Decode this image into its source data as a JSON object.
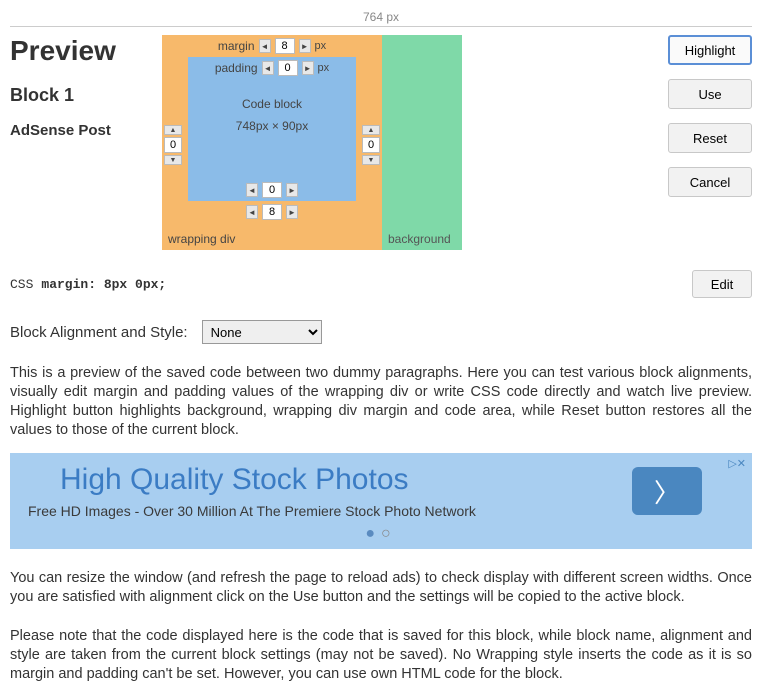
{
  "ruler": "764 px",
  "left": {
    "preview": "Preview",
    "block": "Block 1",
    "adsense": "AdSense Post"
  },
  "diagram": {
    "margin_label": "margin",
    "margin_val": "8",
    "margin_unit": "px",
    "padding_label": "padding",
    "padding_val": "0",
    "padding_unit": "px",
    "code_title": "Code block",
    "code_dims": "748px × 90px",
    "bottom_pad_val": "0",
    "wrap_label": "wrapping div",
    "wrap_val": "8",
    "bg_label": "background",
    "left_outer": "0",
    "left_inner": "0",
    "right_inner": "0",
    "right_outer": "0"
  },
  "buttons": {
    "highlight": "Highlight",
    "use": "Use",
    "reset": "Reset",
    "cancel": "Cancel",
    "edit": "Edit"
  },
  "css": {
    "label": "CSS",
    "code": "margin: 8px 0px;"
  },
  "align": {
    "label": "Block Alignment and Style:",
    "selected": "None",
    "options": [
      "None"
    ]
  },
  "para1": "This is a preview of the saved code between two dummy paragraphs. Here you can test various block alignments, visually edit margin and padding values of the wrapping div or write CSS code directly and watch live preview. Highlight button highlights background, wrapping div margin and code area, while Reset button restores all the values to those of the current block.",
  "ad": {
    "title": "High Quality Stock Photos",
    "sub": "Free HD Images - Over 30 Million At The Premiere Stock Photo Network",
    "close": "▷✕"
  },
  "para2": "You can resize the window (and refresh the page to reload ads) to check display with different screen widths. Once you are satisfied with alignment click on the Use button and the settings will be copied to the active block.",
  "para3": "Please note that the code displayed here is the code that is saved for this block, while block name, alignment and style are taken from the current block settings (may not be saved). No Wrapping style inserts the code as it is so margin and padding can't be set. However, you can use own HTML code for the block."
}
